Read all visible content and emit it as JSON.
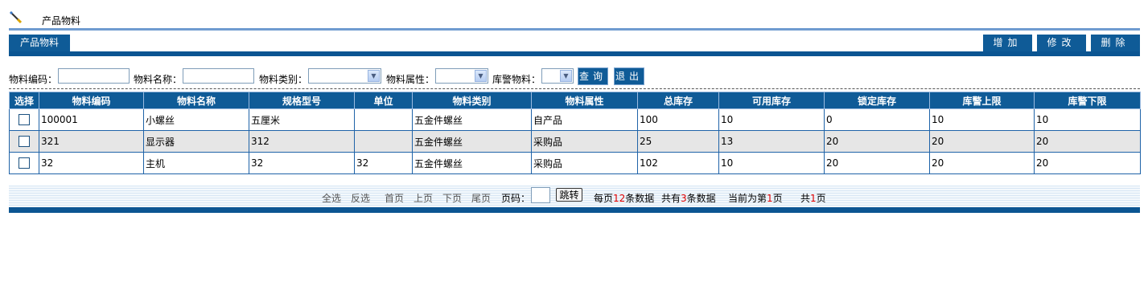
{
  "title_bar": {
    "icon": "pen-icon",
    "title": "产品物料"
  },
  "toolbar": {
    "tab_label": "产品物料",
    "add_label": "增加",
    "edit_label": "修改",
    "delete_label": "删除"
  },
  "filters": {
    "code_label": "物料编码：",
    "code_value": "",
    "name_label": "物料名称：",
    "name_value": "",
    "category_label": "物料类别：",
    "category_value": "",
    "attribute_label": "物料属性：",
    "attribute_value": "",
    "alert_label": "库警物料：",
    "alert_value": "",
    "query_label": "查询",
    "exit_label": "退出"
  },
  "table": {
    "headers": [
      "选择",
      "物料编码",
      "物料名称",
      "规格型号",
      "单位",
      "物料类别",
      "物料属性",
      "总库存",
      "可用库存",
      "锁定库存",
      "库警上限",
      "库警下限"
    ],
    "rows": [
      [
        "100001",
        "小螺丝",
        "五厘米",
        "",
        "五金件螺丝",
        "自产品",
        "100",
        "10",
        "0",
        "10",
        "10"
      ],
      [
        "321",
        "显示器",
        "312",
        "",
        "五金件螺丝",
        "采购品",
        "25",
        "13",
        "20",
        "20",
        "20"
      ],
      [
        "32",
        "主机",
        "32",
        "32",
        "五金件螺丝",
        "采购品",
        "102",
        "10",
        "20",
        "20",
        "20"
      ]
    ]
  },
  "pager": {
    "select_all": "全选",
    "invert": "反选",
    "first": "首页",
    "prev": "上页",
    "next": "下页",
    "last": "尾页",
    "page_label": "页码：",
    "page_value": "",
    "jump": "跳转",
    "per_page_prefix": "每页",
    "per_page_count": "12",
    "per_page_suffix": "条数据",
    "total_prefix": "共有",
    "total_count": "3",
    "total_suffix": "条数据",
    "current_prefix": "当前为第",
    "current_page": "1",
    "current_suffix": "页",
    "pages_prefix": "共",
    "pages_count": "1",
    "pages_suffix": "页"
  },
  "colors": {
    "header_blue": "#0f5b97",
    "accent_line": "#6f9bd0",
    "highlight_red": "#e00000"
  }
}
